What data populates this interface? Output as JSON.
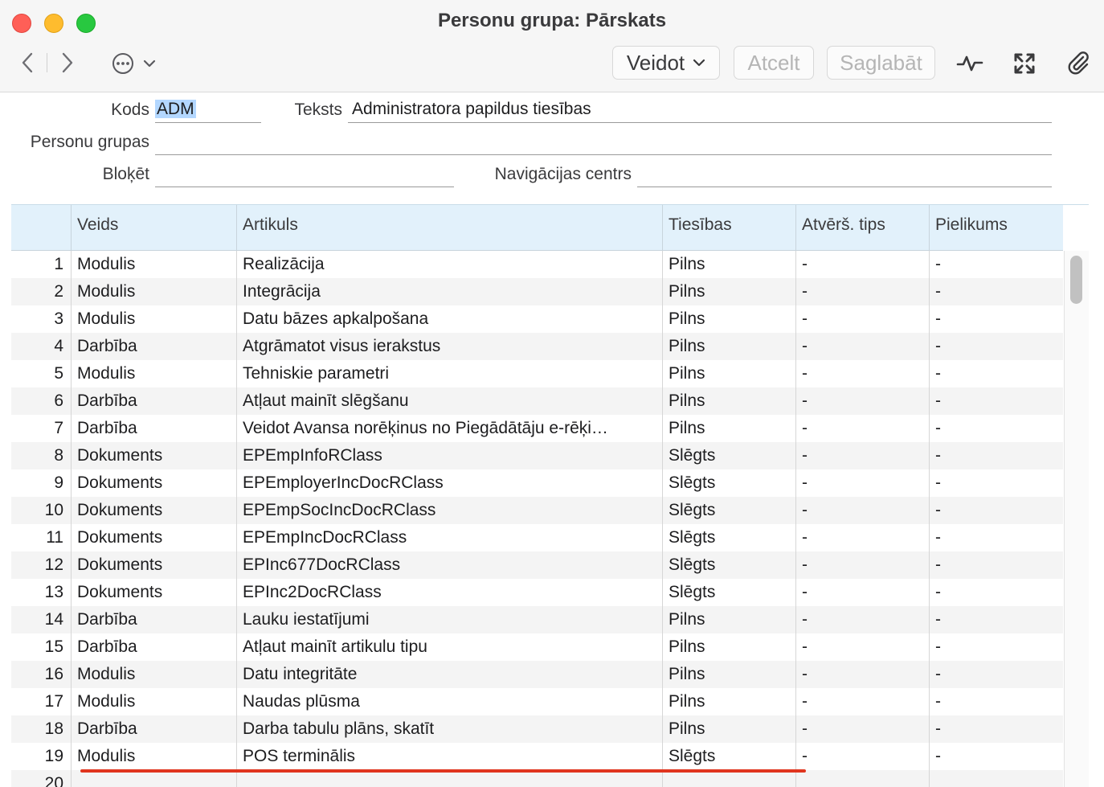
{
  "window": {
    "title": "Personu grupa: Pārskats"
  },
  "toolbar": {
    "create_label": "Veidot",
    "cancel_label": "Atcelt",
    "save_label": "Saglabāt"
  },
  "form": {
    "code_label": "Kods",
    "code_value": "ADM",
    "text_label": "Teksts",
    "text_value": "Administratora papildus tiesības",
    "groups_label": "Personu grupas",
    "groups_value": "",
    "block_label": "Bloķēt",
    "block_value": "",
    "nav_label": "Navigācijas centrs",
    "nav_value": ""
  },
  "table": {
    "headers": [
      "",
      "Veids",
      "Artikuls",
      "Tiesības",
      "Atvērš. tips",
      "Pielikums"
    ],
    "rows": [
      {
        "n": "1",
        "type": "Modulis",
        "item": "Realizācija",
        "rights": "Pilns",
        "open": "-",
        "att": "-"
      },
      {
        "n": "2",
        "type": "Modulis",
        "item": "Integrācija",
        "rights": "Pilns",
        "open": "-",
        "att": "-"
      },
      {
        "n": "3",
        "type": "Modulis",
        "item": "Datu bāzes apkalpošana",
        "rights": "Pilns",
        "open": "-",
        "att": "-"
      },
      {
        "n": "4",
        "type": "Darbība",
        "item": "Atgrāmatot visus ierakstus",
        "rights": "Pilns",
        "open": "-",
        "att": "-"
      },
      {
        "n": "5",
        "type": "Modulis",
        "item": "Tehniskie parametri",
        "rights": "Pilns",
        "open": "-",
        "att": "-"
      },
      {
        "n": "6",
        "type": "Darbība",
        "item": "Atļaut mainīt slēgšanu",
        "rights": "Pilns",
        "open": "-",
        "att": "-"
      },
      {
        "n": "7",
        "type": "Darbība",
        "item": "Veidot Avansa norēķinus no Piegādātāju e-rēķi…",
        "rights": "Pilns",
        "open": "-",
        "att": "-"
      },
      {
        "n": "8",
        "type": "Dokuments",
        "item": "EPEmpInfoRClass",
        "rights": "Slēgts",
        "open": "-",
        "att": "-"
      },
      {
        "n": "9",
        "type": "Dokuments",
        "item": "EPEmployerIncDocRClass",
        "rights": "Slēgts",
        "open": "-",
        "att": "-"
      },
      {
        "n": "10",
        "type": "Dokuments",
        "item": "EPEmpSocIncDocRClass",
        "rights": "Slēgts",
        "open": "-",
        "att": "-"
      },
      {
        "n": "11",
        "type": "Dokuments",
        "item": "EPEmpIncDocRClass",
        "rights": "Slēgts",
        "open": "-",
        "att": "-"
      },
      {
        "n": "12",
        "type": "Dokuments",
        "item": "EPInc677DocRClass",
        "rights": "Slēgts",
        "open": "-",
        "att": "-"
      },
      {
        "n": "13",
        "type": "Dokuments",
        "item": "EPInc2DocRClass",
        "rights": "Slēgts",
        "open": "-",
        "att": "-"
      },
      {
        "n": "14",
        "type": "Darbība",
        "item": "Lauku iestatījumi",
        "rights": "Pilns",
        "open": "-",
        "att": "-"
      },
      {
        "n": "15",
        "type": "Darbība",
        "item": "Atļaut mainīt artikulu tipu",
        "rights": "Pilns",
        "open": "-",
        "att": "-"
      },
      {
        "n": "16",
        "type": "Modulis",
        "item": "Datu integritāte",
        "rights": "Pilns",
        "open": "-",
        "att": "-"
      },
      {
        "n": "17",
        "type": "Modulis",
        "item": "Naudas plūsma",
        "rights": "Pilns",
        "open": "-",
        "att": "-"
      },
      {
        "n": "18",
        "type": "Darbība",
        "item": "Darba tabulu plāns, skatīt",
        "rights": "Pilns",
        "open": "-",
        "att": "-"
      },
      {
        "n": "19",
        "type": "Modulis",
        "item": "POS terminālis",
        "rights": "Slēgts",
        "open": "-",
        "att": "-"
      },
      {
        "n": "20",
        "type": "",
        "item": "",
        "rights": "",
        "open": "",
        "att": ""
      }
    ]
  },
  "colors": {
    "header_bg": "#e2f1fb",
    "highlight_line": "#e0351e",
    "selection": "#b3d7ff"
  },
  "icons": [
    "back-chevron-icon",
    "forward-chevron-icon",
    "more-ellipsis-icon",
    "chevron-down-icon",
    "activity-icon",
    "expand-icon",
    "paperclip-icon"
  ]
}
